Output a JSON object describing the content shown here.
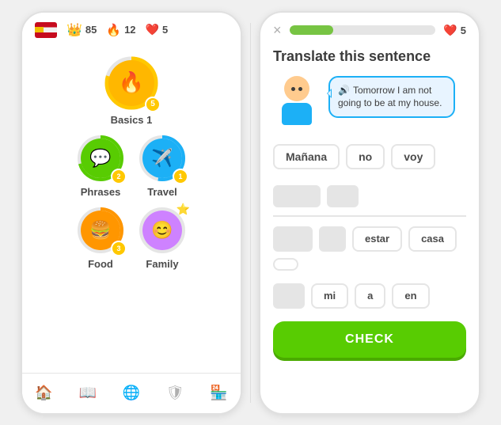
{
  "left": {
    "header": {
      "xp": "85",
      "streak": "12",
      "hearts": "5"
    },
    "lessons": [
      {
        "name": "Basics 1",
        "color_outer": "#ffc800",
        "color_inner": "#ffb700",
        "emoji": "🔥",
        "badge": "5",
        "size": "large"
      },
      {
        "name": "Phrases",
        "color_outer": "#77c443",
        "color_inner": "#58cc02",
        "emoji": "💬",
        "badge": "2",
        "size": "medium"
      },
      {
        "name": "Travel",
        "color_outer": "#1cb0f6",
        "color_inner": "#0099e0",
        "emoji": "✈️",
        "badge": "1",
        "size": "medium"
      },
      {
        "name": "Food",
        "color_outer": "#ff9600",
        "color_inner": "#e08000",
        "emoji": "🍔",
        "badge": "3",
        "size": "medium"
      },
      {
        "name": "Family",
        "color_outer": "#ce82ff",
        "color_inner": "#b44fff",
        "emoji": "😊",
        "badge": "",
        "size": "medium"
      }
    ],
    "nav": [
      {
        "icon": "🏠",
        "label": "home",
        "active": true
      },
      {
        "icon": "📖",
        "label": "lessons",
        "active": false
      },
      {
        "icon": "🌐",
        "label": "explore",
        "active": false
      },
      {
        "icon": "🛡",
        "label": "shield",
        "active": false
      },
      {
        "icon": "🏪",
        "label": "shop",
        "active": false
      }
    ]
  },
  "right": {
    "header": {
      "close": "×",
      "progress": 30,
      "hearts": "5"
    },
    "title": "Translate this sentence",
    "speech_text": "Tomorrow I am not going to be at my house.",
    "word_choices": [
      "Mañana",
      "no",
      "voy"
    ],
    "answer_slots": [
      {
        "size": "normal"
      },
      {
        "size": "small"
      },
      {
        "size": "normal"
      }
    ],
    "word_bank": [
      "estar",
      "casa",
      "mi",
      "a",
      "en"
    ],
    "check_label": "CHECK"
  }
}
